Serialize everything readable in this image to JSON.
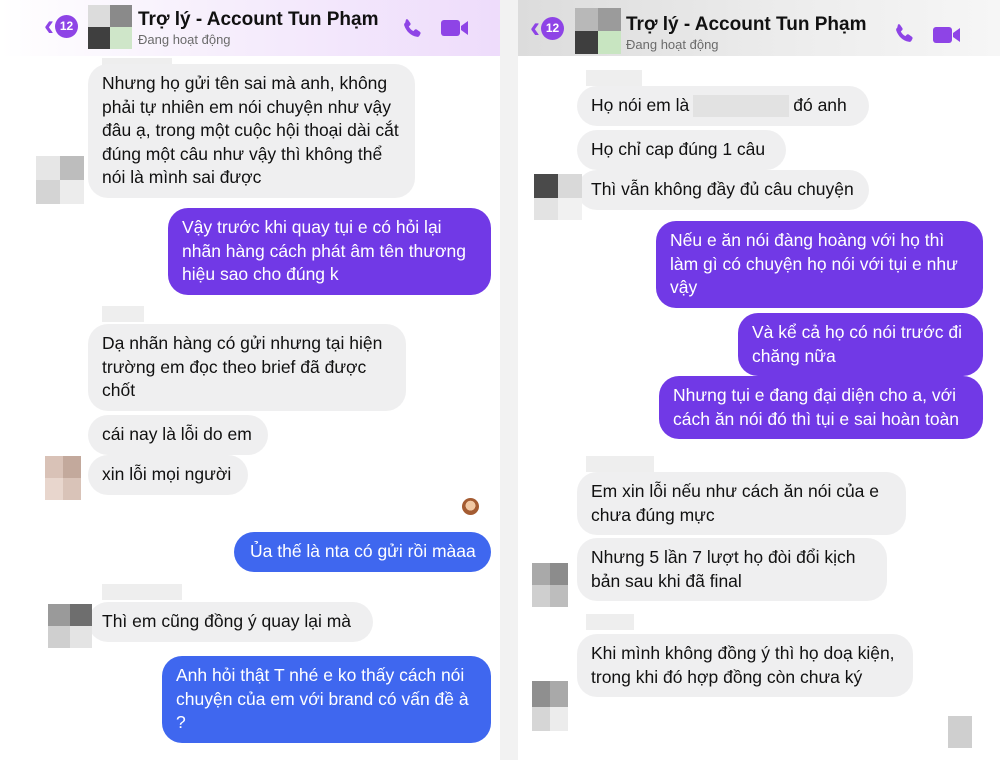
{
  "left": {
    "header": {
      "badge": "12",
      "title": "Trợ lý - Account Tun Phạm",
      "status": "Đang hoạt động"
    },
    "messages": [
      "Nhưng họ gửi tên sai mà anh, không phải tự nhiên em nói chuyện như vậy đâu ạ, trong một cuộc hội thoại dài cắt đúng một câu như vậy thì không thể nói là mình sai được",
      "Vậy trước khi quay tụi e có hỏi lại nhãn hàng cách phát âm tên thương hiệu sao cho đúng k",
      "Dạ nhãn hàng có gửi nhưng tại hiện trường em đọc theo brief đã được chốt",
      "cái nay là lỗi do em",
      "xin lỗi mọi người",
      "Ủa thế là nta có gửi rồi màaa",
      "Thì em cũng đồng ý quay lại mà",
      "Anh hỏi thật T nhé e ko thấy cách nói chuyện của em với brand có vấn đề à ?"
    ]
  },
  "right": {
    "header": {
      "badge": "12",
      "title": "Trợ lý - Account Tun Phạm",
      "status": "Đang hoạt động"
    },
    "messages": {
      "m1_prefix": "Họ nói em là",
      "m1_suffix": "đó anh",
      "m2": "Họ chỉ cap đúng 1 câu",
      "m3": "Thì vẫn không đầy đủ câu chuyện",
      "m4": "Nếu e ăn nói đàng hoàng với họ thì làm gì có chuyện họ nói với tụi e như vậy",
      "m5": "Và kể cả họ có nói trước đi chăng nữa",
      "m6": "Nhưng tụi e đang đại diện cho a, với cách ăn nói đó thì tụi e sai hoàn toàn",
      "m7": "Em xin lỗi nếu như cách ăn nói của e chưa đúng mực",
      "m8": "Nhưng 5 lần 7 lượt họ đòi đổi kịch bản sau khi đã final",
      "m9": "Khi mình không đồng ý thì họ doạ kiện, trong khi đó hợp đồng còn chưa ký"
    }
  },
  "colors": {
    "accent": "#8e44e6",
    "sent_violet": "#7139e6",
    "sent_blue": "#3f67ef",
    "received": "#efeff0"
  },
  "icons": [
    "back-chevron-icon",
    "phone-icon",
    "video-camera-icon"
  ]
}
